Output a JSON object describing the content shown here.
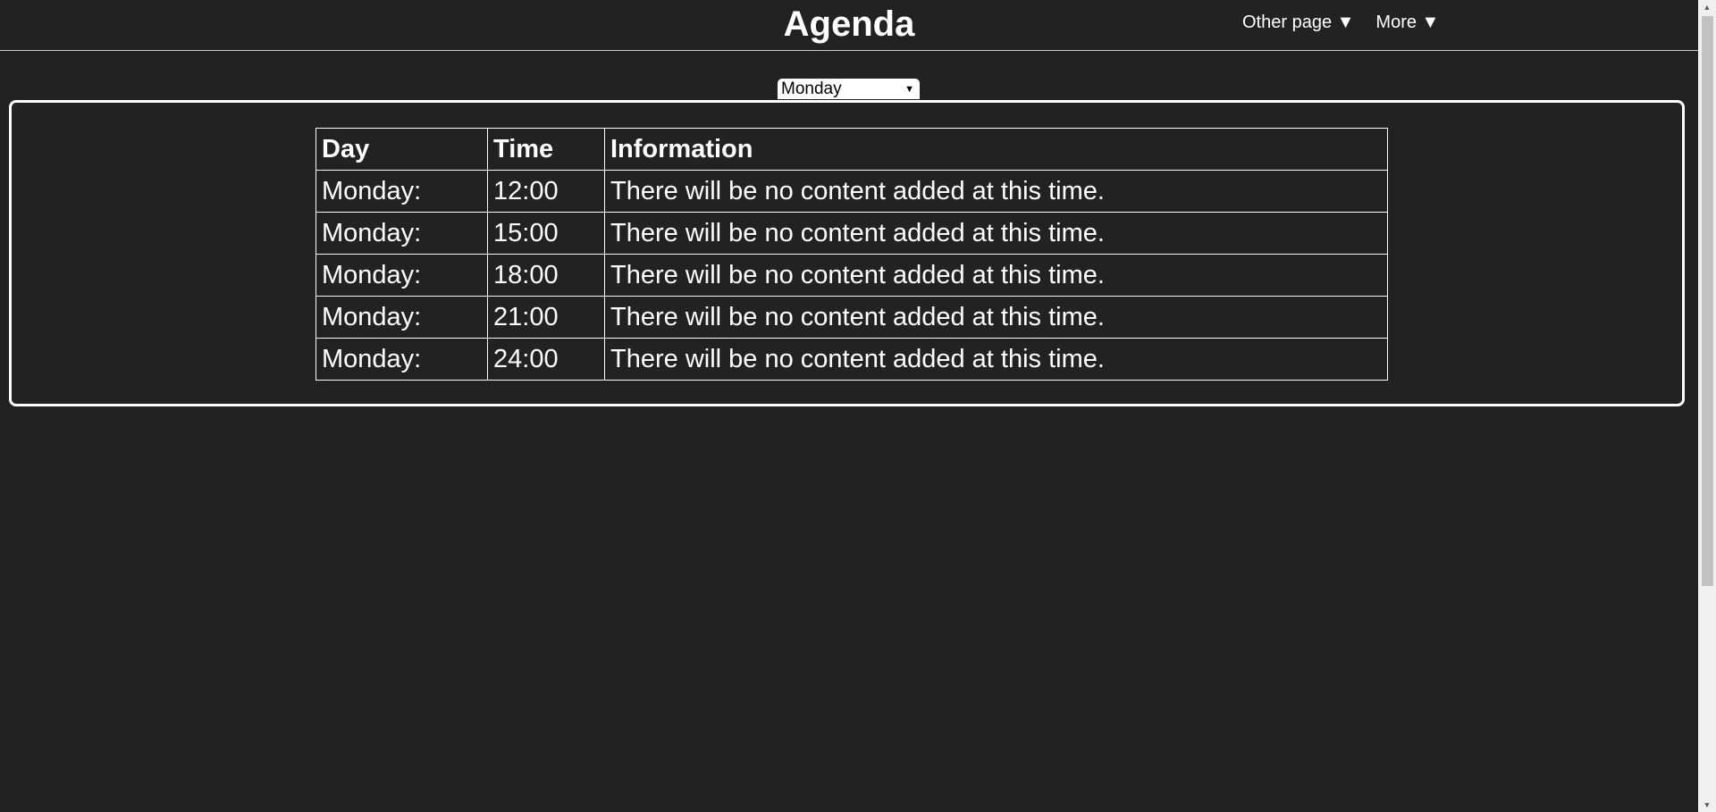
{
  "header": {
    "title": "Agenda",
    "nav": [
      {
        "label": "Other page ▼"
      },
      {
        "label": "More ▼"
      }
    ]
  },
  "day_select": {
    "selected": "Monday",
    "arrow": "▼"
  },
  "table": {
    "columns": [
      "Day",
      "Time",
      "Information"
    ],
    "rows": [
      {
        "day": "Monday:",
        "time": "12:00",
        "info": "There will be no content added at this time."
      },
      {
        "day": "Monday:",
        "time": "15:00",
        "info": "There will be no content added at this time."
      },
      {
        "day": "Monday:",
        "time": "18:00",
        "info": "There will be no content added at this time."
      },
      {
        "day": "Monday:",
        "time": "21:00",
        "info": "There will be no content added at this time."
      },
      {
        "day": "Monday:",
        "time": "24:00",
        "info": "There will be no content added at this time."
      }
    ]
  },
  "scrollbar": {
    "up_icon": "▲",
    "down_icon": "▼"
  },
  "colors": {
    "background": "#222222",
    "text": "#ffffff",
    "border": "#ffffff"
  }
}
